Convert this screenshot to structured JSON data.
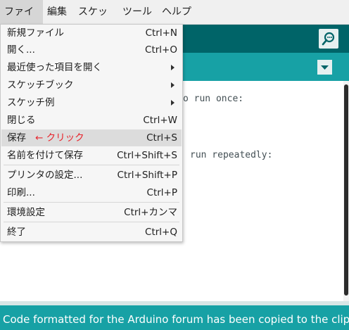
{
  "menubar": {
    "items": [
      "ファイル",
      "編集",
      "スケッチ",
      "ツール",
      "ヘルプ"
    ]
  },
  "editor": {
    "lines": [
      "o run once:",
      "run repeatedly:"
    ]
  },
  "file_menu": {
    "items": [
      {
        "label": "新規ファイル",
        "shortcut": "Ctrl+N"
      },
      {
        "label": "開く...",
        "shortcut": "Ctrl+O"
      },
      {
        "label": "最近使った項目を開く",
        "submenu": true
      },
      {
        "label": "スケッチブック",
        "submenu": true
      },
      {
        "label": "スケッチ例",
        "submenu": true
      },
      {
        "label": "閉じる",
        "shortcut": "Ctrl+W"
      },
      {
        "label": "保存",
        "shortcut": "Ctrl+S",
        "annotation": "← クリック"
      },
      {
        "label": "名前を付けて保存",
        "shortcut": "Ctrl+Shift+S"
      },
      {
        "label": "プリンタの設定...",
        "shortcut": "Ctrl+Shift+P"
      },
      {
        "label": "印刷...",
        "shortcut": "Ctrl+P"
      },
      {
        "label": "環境設定",
        "shortcut": "Ctrl+カンマ"
      },
      {
        "label": "終了",
        "shortcut": "Ctrl+Q"
      }
    ]
  },
  "status": {
    "message": "Code formatted for the Arduino forum has been copied to the clipboard."
  },
  "colors": {
    "toolbar": "#006468",
    "tabbar": "#17a1a5",
    "annotation": "#e8242c"
  }
}
